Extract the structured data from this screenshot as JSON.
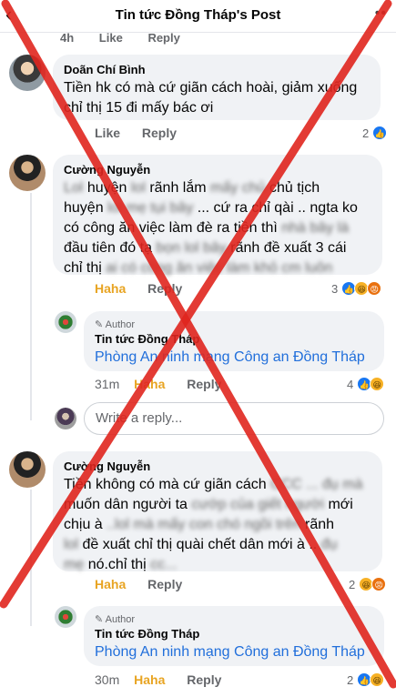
{
  "header": {
    "title": "Tin tức Đồng Tháp's Post",
    "back_icon": "‹",
    "more_icon": "••"
  },
  "previous_comment": {
    "time": "4h",
    "like": "Like",
    "reply": "Reply"
  },
  "comments": [
    {
      "name": "Doãn Chí Bình",
      "text_line1": "Tiền hk có mà cứ giãn cách hoài, giảm xuống",
      "text_line2": "chỉ thị 15 đi mấy bác ơi",
      "like": "Like",
      "reply": "Reply",
      "reaction_count": "2"
    },
    {
      "name": "Cường Nguyễn",
      "line1_a": "Lol",
      "line1_b": "huyện",
      "line1_c": "lol",
      "line1_d": "rãnh lắm",
      "line1_e": "mấy chủ",
      "line1_f": "chủ tịch",
      "line2_a": "huyện",
      "line2_b": "lol mẹ tụi bây",
      "line2_c": "... cứ ra chỉ qài .. ngta ko",
      "line3_a": "có công ăn việc làm đè ra tiền thì",
      "line3_b": "nhà bây là",
      "line4_a": "đầu tiên đó tạ",
      "line4_b": "bọn lol bây",
      "line4_c": "rãnh đề xuất 3 cái",
      "line5_a": "chỉ thị",
      "line5_b": "ai có công ăn việc làm khỏ cm luôn",
      "haha": "Haha",
      "reply": "Reply",
      "reaction_count": "3"
    },
    {
      "name": "Cường Nguyễn",
      "line1_a": "Tiền không có mà cứ giãn cách",
      "line1_b": "CCC ... đụ mà",
      "line2_a": "muốn dân người ta",
      "line2_b": "cướp của giết người",
      "line2_c": "mới",
      "line3_a": "chịu à",
      "line3_b": "..lol mà mấy con chó ngồi trên",
      "line3_c": "rãnh",
      "line4_a": "lol",
      "line4_b": "đề xuất chỉ thị quài chết dân mới à ..",
      "line4_c": "đụ",
      "line5_a": "mẹ",
      "line5_b": "nó.chỉ thị",
      "line5_c": "cc...",
      "haha": "Haha",
      "reply": "Reply",
      "reaction_count": "2"
    }
  ],
  "author_replies": [
    {
      "tag": "Author",
      "name": "Tin tức Đồng Tháp",
      "text": "Phòng An ninh mạng Công an Đồng Tháp",
      "time": "31m",
      "haha": "Haha",
      "reply": "Reply",
      "reaction_count": "4"
    },
    {
      "tag": "Author",
      "name": "Tin tức Đồng Tháp",
      "text": "Phòng An ninh mạng Công an Đồng Tháp",
      "time": "30m",
      "haha": "Haha",
      "reply": "Reply",
      "reaction_count": "2"
    }
  ],
  "reply_box": {
    "placeholder": "Write a reply..."
  },
  "colors": {
    "overlay_x": "#e0261f",
    "link": "#216fdb",
    "haha": "#e8a422"
  },
  "icons": {
    "author": "pencil-icon",
    "like": "like-icon",
    "haha": "haha-icon",
    "angry": "angry-icon"
  }
}
